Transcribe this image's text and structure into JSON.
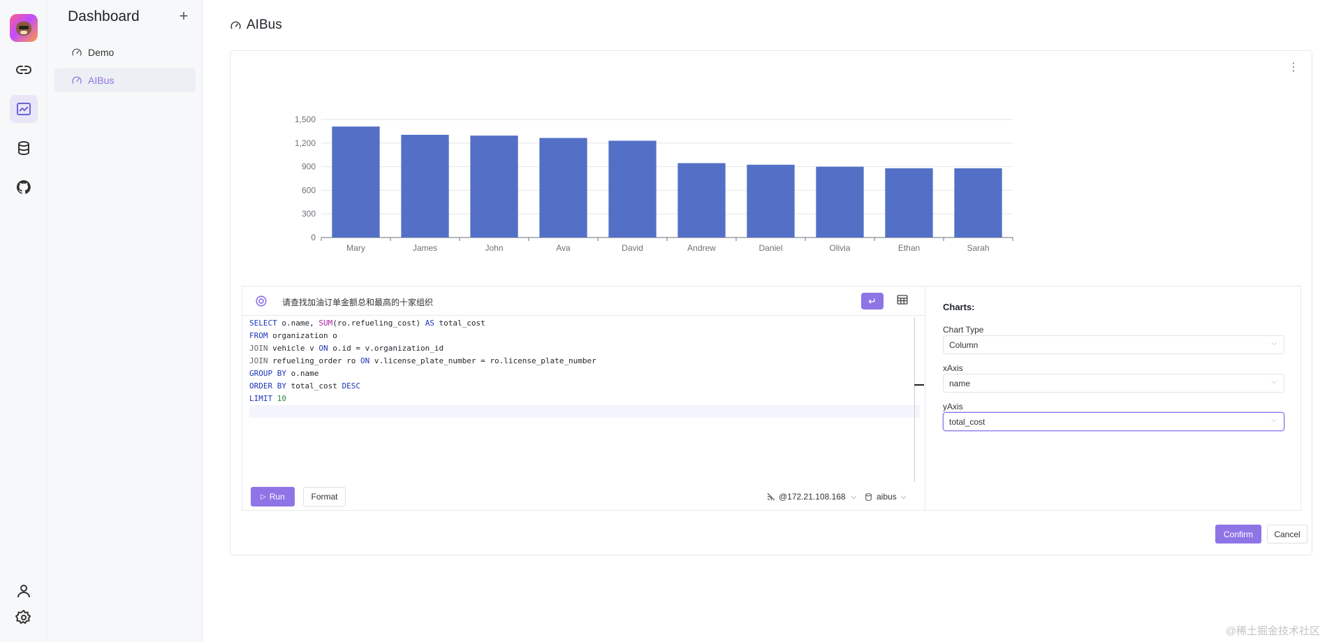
{
  "sidebar": {
    "title": "Dashboard",
    "add_label": "+",
    "items": [
      {
        "label": "Demo"
      },
      {
        "label": "AIBus"
      }
    ]
  },
  "page": {
    "title": "AIBus"
  },
  "chart_data": {
    "type": "bar",
    "categories": [
      "Mary",
      "James",
      "John",
      "Ava",
      "David",
      "Andrew",
      "Daniel",
      "Olivia",
      "Ethan",
      "Sarah"
    ],
    "values": [
      1410,
      1305,
      1295,
      1265,
      1230,
      945,
      925,
      900,
      880,
      880
    ],
    "yticks": [
      "0",
      "300",
      "600",
      "900",
      "1,200",
      "1,500"
    ],
    "ylim": [
      0,
      1500
    ],
    "color": "#5470c6",
    "grid": true
  },
  "editor": {
    "prompt": "请查找加油订单金额总和最高的十家组织",
    "code_lines": [
      [
        {
          "t": "SELECT",
          "c": "kw"
        },
        {
          "t": " o.name, "
        },
        {
          "t": "SUM",
          "c": "fn"
        },
        {
          "t": "(ro.refueling_cost) "
        },
        {
          "t": "AS",
          "c": "kw"
        },
        {
          "t": " total_cost"
        }
      ],
      [
        {
          "t": "FROM",
          "c": "kw"
        },
        {
          "t": " organization o"
        }
      ],
      [
        {
          "t": "JOIN",
          "c": "cm"
        },
        {
          "t": " vehicle v "
        },
        {
          "t": "ON",
          "c": "kw"
        },
        {
          "t": " o.id = v.organization_id"
        }
      ],
      [
        {
          "t": "JOIN",
          "c": "cm"
        },
        {
          "t": " refueling_order ro "
        },
        {
          "t": "ON",
          "c": "kw"
        },
        {
          "t": " v.license_plate_number = ro.license_plate_number"
        }
      ],
      [
        {
          "t": "GROUP BY",
          "c": "kw"
        },
        {
          "t": " o.name"
        }
      ],
      [
        {
          "t": "ORDER BY",
          "c": "kw"
        },
        {
          "t": " total_cost "
        },
        {
          "t": "DESC",
          "c": "kw"
        }
      ],
      [
        {
          "t": "LIMIT",
          "c": "kw"
        },
        {
          "t": " "
        },
        {
          "t": "10",
          "c": "num"
        }
      ],
      [
        {
          "t": ""
        }
      ]
    ],
    "run_label": "Run",
    "format_label": "Format",
    "connection": "@172.21.108.168",
    "database": "aibus"
  },
  "config": {
    "heading": "Charts:",
    "chart_type_label": "Chart Type",
    "chart_type_value": "Column",
    "xaxis_label": "xAxis",
    "xaxis_value": "name",
    "yaxis_label": "yAxis",
    "yaxis_value": "total_cost"
  },
  "actions": {
    "confirm": "Confirm",
    "cancel": "Cancel"
  },
  "watermark": "@稀土掘金技术社区"
}
